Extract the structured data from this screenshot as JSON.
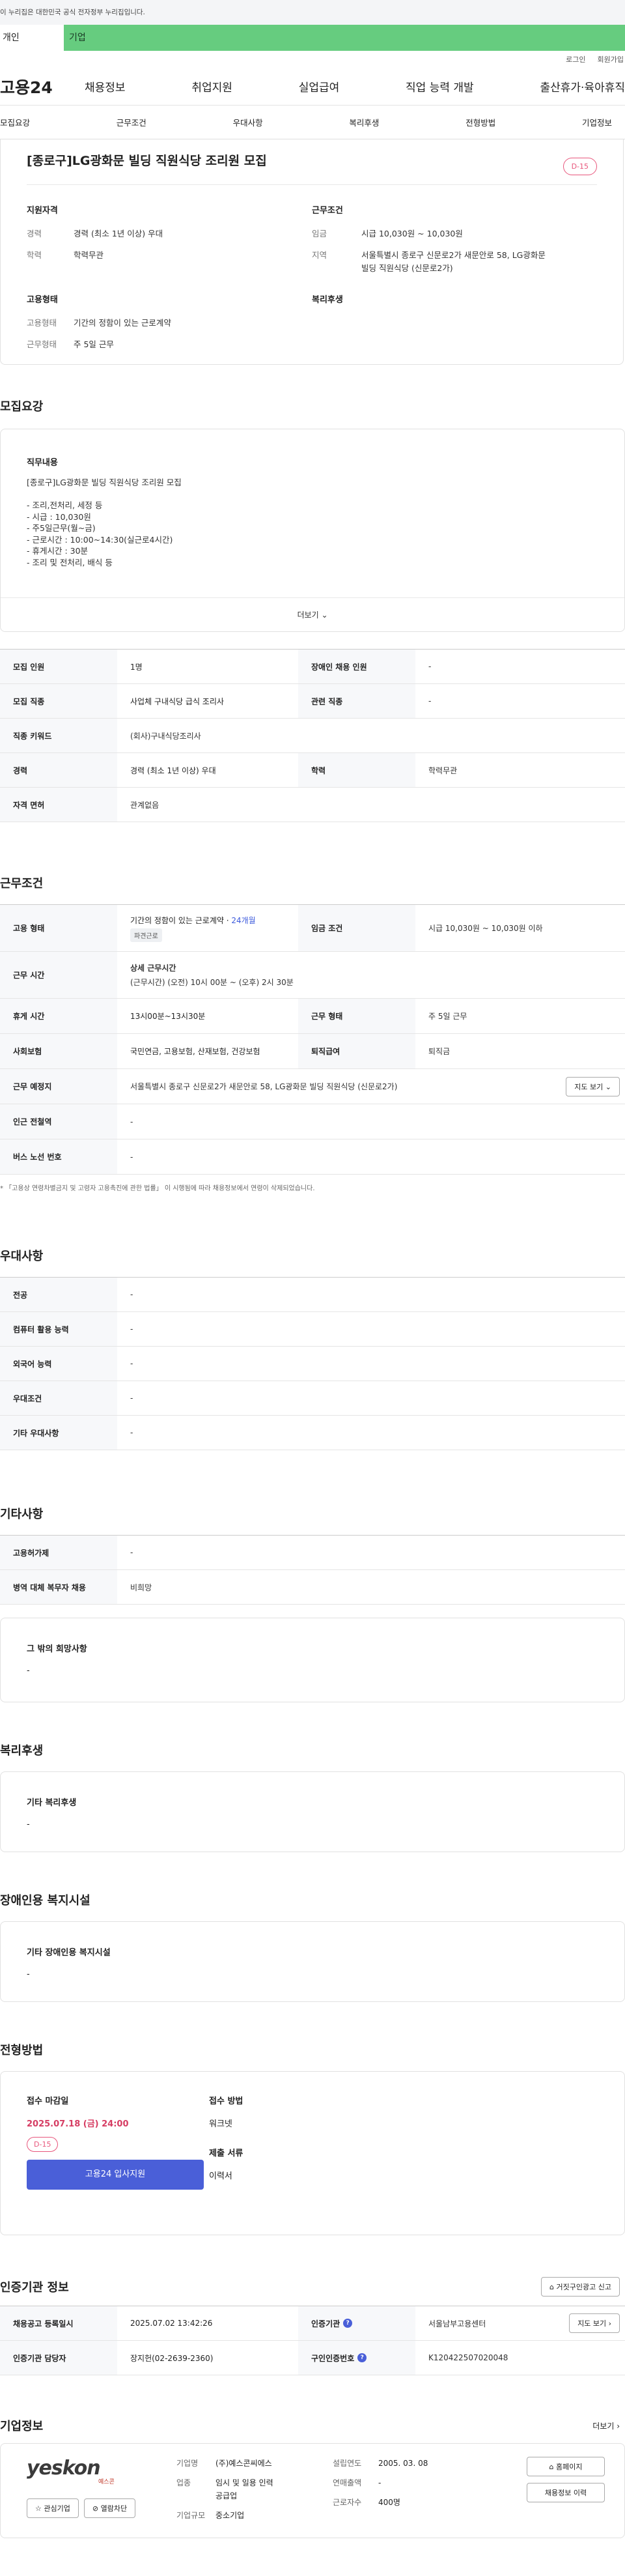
{
  "topbar": {
    "notice": "이 누리집은 대한민국 공식 전자정부 누리집입니다."
  },
  "tabs": {
    "personal": "개인",
    "biz": "기업"
  },
  "util": {
    "login": "로그인",
    "join": "회원가입"
  },
  "gnb": {
    "logo": "고용24",
    "items": [
      "채용정보",
      "취업지원",
      "실업급여",
      "직업 능력 개발",
      "출산휴가·육아휴직"
    ]
  },
  "subnav": [
    "모집요강",
    "근무조건",
    "우대사항",
    "복리후생",
    "전형방법",
    "기업정보"
  ],
  "job": {
    "title": "[종로구]LG광화문 빌딩 직원식당 조리원 모집",
    "dday": "D-15",
    "qual_h": "지원자격",
    "career_k": "경력",
    "career_v": "경력 (최소 1년 이상) 우대",
    "edu_k": "학력",
    "edu_v": "학력무관",
    "cond_h": "근무조건",
    "wage_k": "임금",
    "wage_v": "시급 10,030원 ~ 10,030원",
    "region_k": "지역",
    "region_v1": "서울특별시 종로구 신문로2가 새문안로 58, LG광화문",
    "region_v2": "빌딩 직원식당 (신문로2가)",
    "emp_h": "고용형태",
    "emptype_k": "고용형태",
    "emptype_v": "기간의 정함이 있는 근로계약",
    "worktype_k": "근무형태",
    "worktype_v": "주 5일 근무",
    "welfare_h": "복리후생"
  },
  "recruit": {
    "heading": "모집요강",
    "duty_h": "직무내용",
    "duty_lines": [
      "[종로구]LG광화문 빌딩 직원식당 조리원 모집",
      "",
      "- 조리,전처리, 세정 등",
      "- 시급 : 10,030원",
      "- 주5일근무(월~금)",
      "- 근로시간 : 10:00~14:30(실근로4시간)",
      "- 휴게시간 : 30분",
      "- 조리 및 전처리, 배식 등"
    ],
    "more": "더보기",
    "rows": [
      {
        "k1": "모집 인원",
        "v1": "1명",
        "k2": "장애인 채용 인원",
        "v2": "-"
      },
      {
        "k1": "모집 직종",
        "v1": "사업체 구내식당 급식 조리사",
        "k2": "관련 직종",
        "v2": "-"
      },
      {
        "k1": "직종 키워드",
        "v1": "(회사)구내식당조리사"
      },
      {
        "k1": "경력",
        "v1": "경력 (최소 1년 이상) 우대",
        "k2": "학력",
        "v2": "학력무관"
      },
      {
        "k1": "자격 면허",
        "v1": "관계없음"
      }
    ]
  },
  "cond": {
    "heading": "근무조건",
    "emp_k": "고용 형태",
    "emp_v": "기간의 정함이 있는 근로계약 · ",
    "emp_months": "24개월",
    "emp_chip": "파견근로",
    "wage_k": "임금 조건",
    "wage_v": "시급 10,030원 ~ 10,030원 이하",
    "time_k": "근무 시간",
    "time_h": "상세 근무시간",
    "time_v": "(근무시간) (오전) 10시 00분 ~ (오후) 2시 30분",
    "break_k": "휴게 시간",
    "break_v": "13시00분~13시30분",
    "worktype_k": "근무 형태",
    "worktype_v": "주 5일 근무",
    "ins_k": "사회보험",
    "ins_v": "국민연금, 고용보험, 산재보험, 건강보험",
    "retire_k": "퇴직급여",
    "retire_v": "퇴직금",
    "place_k": "근무 예정지",
    "place_v": "서울특별시 종로구 신문로2가 새문안로 58, LG광화문 빌딩 직원식당 (신문로2가)",
    "map_btn": "지도 보기",
    "subway_k": "인근 전철역",
    "subway_v": "-",
    "bus_k": "버스 노선 번호",
    "bus_v": "-",
    "note": "* 「고용상 연령차별금지 및 고령자 고용촉진에 관한 법률」 이 시행됨에 따라 채용정보에서 연령이 삭제되었습니다."
  },
  "pref": {
    "heading": "우대사항",
    "rows": [
      {
        "k": "전공",
        "v": "-"
      },
      {
        "k": "컴퓨터 활용 능력",
        "v": "-"
      },
      {
        "k": "외국어 능력",
        "v": "-"
      },
      {
        "k": "우대조건",
        "v": "-"
      },
      {
        "k": "기타 우대사항",
        "v": "-"
      }
    ]
  },
  "etc": {
    "heading": "기타사항",
    "rows": [
      {
        "k": "고용허가제",
        "v": "-"
      },
      {
        "k": "병역 대체 복무자 채용",
        "v": "비희망"
      }
    ],
    "box_h": "그 밖의 희망사항",
    "box_v": "-"
  },
  "welfare": {
    "heading": "복리후생",
    "box_h": "기타 복리후생",
    "box_v": "-"
  },
  "disab": {
    "heading": "장애인용 복지시설",
    "box_h": "기타 장애인용 복지시설",
    "box_v": "-"
  },
  "select": {
    "heading": "전형방법",
    "deadline_h": "접수 마감일",
    "deadline_v": "2025.07.18 (금) 24:00",
    "dday": "D-15",
    "apply_btn": "고용24 입사지원",
    "method_h": "접수 방법",
    "method_v": "워크넷",
    "docs_h": "제출 서류",
    "docs_v": "이력서"
  },
  "cert": {
    "heading": "인증기관 정보",
    "report_btn": "거짓구인광고 신고",
    "reg_k": "채용공고 등록일시",
    "reg_v": "2025.07.02 13:42:26",
    "org_k": "인증기관",
    "org_v": "서울남부고용센터",
    "map_btn": "지도 보기",
    "mgr_k": "인증기관 담당자",
    "mgr_v": "장지헌(02-2639-2360)",
    "no_k": "구인인증번호",
    "no_v": "K120422507020048"
  },
  "company": {
    "heading": "기업정보",
    "more": "더보기",
    "logo": "yeskon",
    "logo_sub": "예스콘",
    "interest_btn": "관심기업",
    "block_btn": "열람차단",
    "name_k": "기업명",
    "name_v": "(주)예스콘씨에스",
    "industry_k": "업종",
    "industry_v1": "임시 및 일용 인력",
    "industry_v2": "공급업",
    "scale_k": "기업규모",
    "scale_v": "중소기업",
    "found_k": "설립연도",
    "found_v": "2005. 03. 08",
    "sales_k": "연매출액",
    "sales_v": "-",
    "emp_k": "근로자수",
    "emp_v": "400명",
    "home_btn": "홈페이지",
    "jobs_btn": "채용정보 이력"
  }
}
